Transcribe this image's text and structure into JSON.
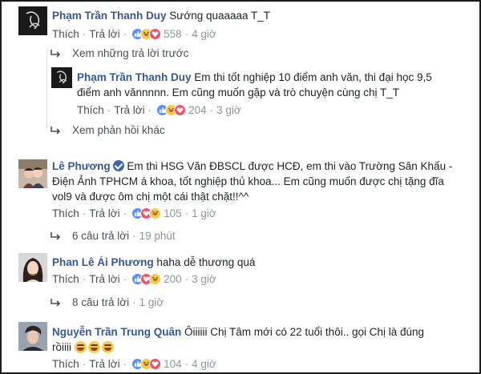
{
  "comments": [
    {
      "author": "Phạm Trần Thanh Duy",
      "text": "Sướng quaaaaa T_T",
      "like_label": "Thích",
      "reply_label": "Trả lời",
      "reaction_count": "558",
      "time": "4 giờ"
    },
    {
      "author": "Phạm Trần Thanh Duy",
      "text": "Em thi tốt nghiệp 10 điểm anh văn, thi đại học 9,5 điểm anh vănnnnn. Em cũng muốn gặp và trò chuyện cùng chị T_T",
      "like_label": "Thích",
      "reply_label": "Trả lời",
      "reaction_count": "204",
      "time": "3 giờ"
    },
    {
      "author": "Lê Phương",
      "text": "Em thi HSG Văn ĐBSCL được HCĐ, em thi vào Trường Sân Khấu - Điện Ảnh TPHCM á khoa, tốt nghiệp thủ khoa... Em cũng muốn được chị tặng đĩa vol9 và được ôm chị một cái thật chặt!!^^",
      "like_label": "Thích",
      "reply_label": "Trả lời",
      "reaction_count": "105",
      "time": "1 giờ"
    },
    {
      "author": "Phan Lê Ái Phương",
      "text": "haha dễ thương quá",
      "like_label": "Thích",
      "reply_label": "Trả lời",
      "reaction_count": "200",
      "time": "3 giờ"
    },
    {
      "author": "Nguyễn Trần Trung Quân",
      "text_line1": "Ôiiiiii Chị Tâm mới có 22 tuổi thôi.. gọi Chị là đúng",
      "text_line2": "rồiiii",
      "like_label": "Thích",
      "reply_label": "Trả lời",
      "reaction_count": "104",
      "time": "4 giờ"
    }
  ],
  "reply_links": {
    "previous_replies": "Xem những trả lời trước",
    "other_replies": "Xem phản hồi khác",
    "thread_le_phuong": "6 câu trả lời",
    "thread_le_phuong_time": "19 phút",
    "thread_ai_phuong": "8 câu trả lời",
    "thread_ai_phuong_time": "1 giờ"
  },
  "colors": {
    "name": "#365899",
    "meta": "#90949c",
    "like_reaction": "#5890ff",
    "love_reaction": "#f25268",
    "haha_reaction": "#f7c84a"
  },
  "icons": [
    "like-reaction-icon",
    "love-reaction-icon",
    "haha-reaction-icon",
    "reply-arrow-icon",
    "verified-badge-icon",
    "laughing-emoji-icon"
  ]
}
